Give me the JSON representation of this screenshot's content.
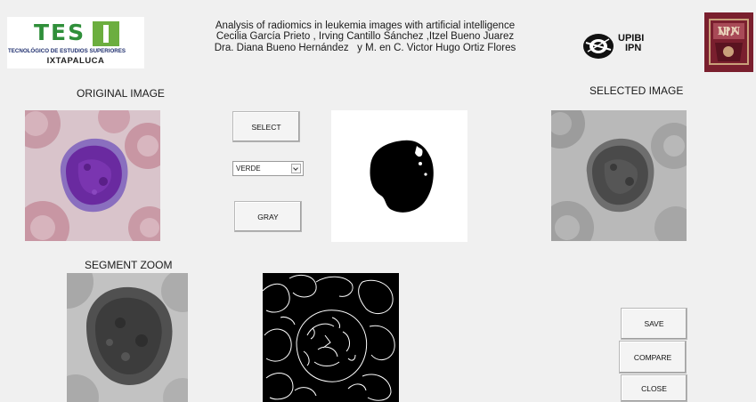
{
  "header": {
    "tes_logo": {
      "word": "TES",
      "subtitle": "TECNOLÓGICO DE ESTUDIOS SUPERIORES",
      "city": "IXTAPALUCA"
    },
    "title": "Analysis of radiomics in leukemia images with artificial intelligence",
    "authors_line1": "Cecilia García Prieto , Irving Cantillo Sánchez ,Itzel Bueno Juarez",
    "authors_line2": "Dra. Diana Bueno Hernández   y M. en C. Victor Hugo Ortiz Flores",
    "upibi_logo": {
      "line1": "UPIBI",
      "line2": "IPN"
    },
    "ipn_seal": {
      "text": "IPN"
    }
  },
  "labels": {
    "original_image": "ORIGINAL IMAGE",
    "selected_image": "SELECTED IMAGE",
    "segment_zoom": "SEGMENT ZOOM"
  },
  "controls": {
    "select_button": "SELECT",
    "channel_dropdown": {
      "selected": "VERDE"
    },
    "gray_button": "GRAY",
    "save_button": "SAVE",
    "compare_button": "COMPARE",
    "close_button": "CLOSE"
  },
  "colors": {
    "background": "#f0f0f0",
    "tes_green": "#2f8f3a",
    "cell_purple": "#6a2aa0",
    "ipn_maroon": "#7a1f2e"
  }
}
